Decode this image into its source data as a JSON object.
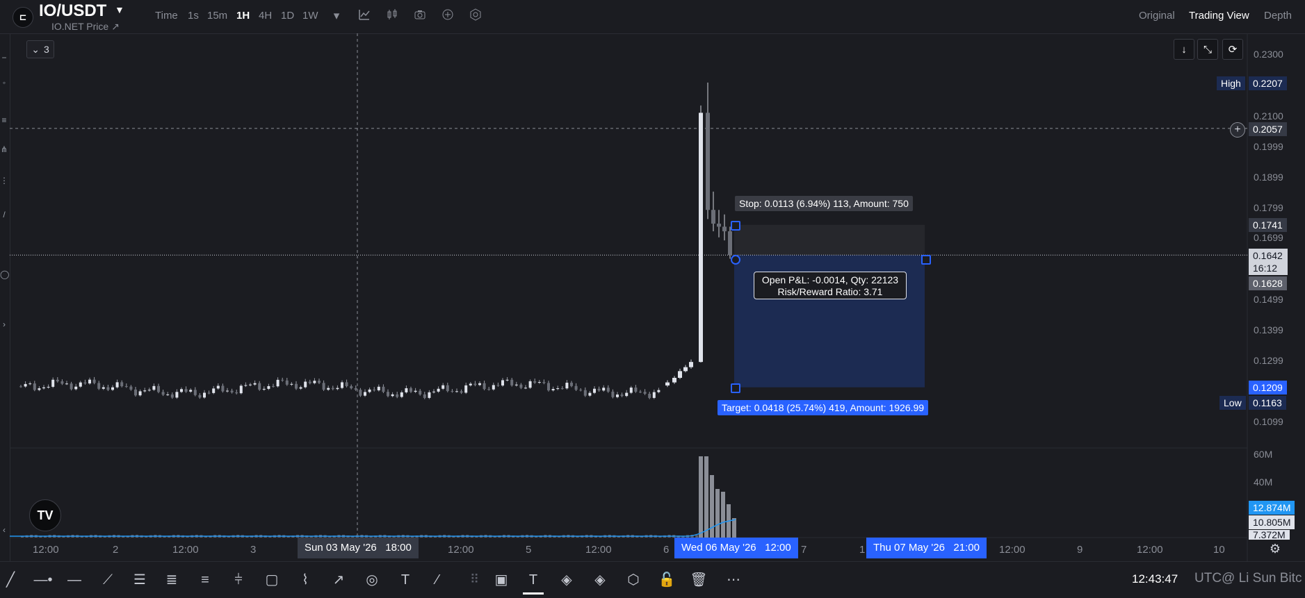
{
  "header": {
    "symbol": "IO/USDT",
    "symbol_caret": "▼",
    "subtitle": "IO.NET Price ↗",
    "intervals": [
      "Time",
      "1s",
      "15m",
      "1H",
      "4H",
      "1D",
      "1W"
    ],
    "active_interval": "1H",
    "icons": [
      "chevron-down-icon",
      "indicators-icon",
      "candles-icon",
      "camera-icon",
      "plus-circle-icon",
      "settings-icon"
    ],
    "views": [
      "Original",
      "Trading View",
      "Depth"
    ],
    "active_view": "Trading View"
  },
  "chart": {
    "legend_count": "3",
    "legend_caret": "⌄",
    "price_ticks": [
      "0.2300",
      "0.2100",
      "0.1999",
      "0.1899",
      "0.1799",
      "0.1699",
      "0.1499",
      "0.1399",
      "0.1299",
      "0.1099"
    ],
    "volume_ticks": [
      "60M",
      "40M",
      "7.372M"
    ],
    "high_label": "High",
    "high_value": "0.2207",
    "low_label": "Low",
    "low_value": "0.1163",
    "crosshair_price": "0.2057",
    "stop_price": "0.1741",
    "last_price": "0.1642",
    "countdown": "16:12",
    "entry_price": "0.1628",
    "target_price": "0.1209",
    "volume_value_1": "12.874M",
    "volume_value_2": "10.805M",
    "time_ticks": [
      "12:00",
      "2",
      "12:00",
      "3",
      "12:00",
      "5",
      "12:00",
      "6",
      "7",
      "1",
      "12:00",
      "9",
      "12:00",
      "10"
    ],
    "crosshair_time": "Sun 03 May '26   18:00",
    "range_start_time": "Wed 06 May '26   12:00",
    "range_end_time": "Thu 07 May '26   21:00",
    "position": {
      "stop_text": "Stop: 0.0113 (6.94%) 113, Amount: 750",
      "target_text": "Target: 0.0418 (25.74%) 419, Amount: 1926.99",
      "pnl_text": "Open P&L: -0.0014, Qty: 22123",
      "rr_text": "Risk/Reward Ratio: 3.71"
    },
    "logo_text": "TV"
  },
  "colors": {
    "background": "#1b1c21",
    "accent_blue": "#2962ff",
    "target_zone": "#1c2b52",
    "stop_zone": "#26272c",
    "candle": "#e0e3eb"
  },
  "bottom_bar": {
    "tool_icons": [
      "trend-line-icon",
      "horizontal-ray-icon",
      "horizontal-line-icon",
      "polyline-icon",
      "parallel-channel-icon",
      "fib-retracement-icon",
      "fib-extension-icon",
      "pitchfork-icon",
      "rectangle-icon",
      "path-icon",
      "arrow-icon",
      "circle-icon",
      "text-icon",
      "ray-icon",
      "drag-handle-icon",
      "layout-icon",
      "text-tool-icon",
      "paint-bucket-icon",
      "paint-bucket-alt-icon",
      "hexagon-icon",
      "lock-icon",
      "trash-icon",
      "more-icon"
    ],
    "clock": "12:43:47",
    "footer_text": "UTC@ Li Sun Bitc"
  }
}
